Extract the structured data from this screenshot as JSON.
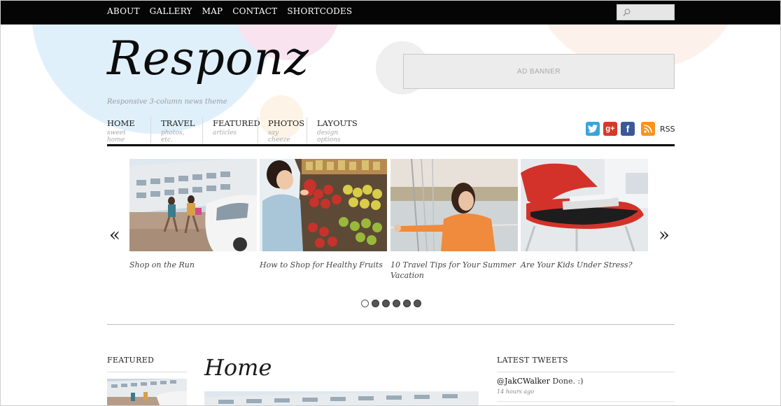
{
  "topnav": {
    "items": [
      {
        "label": "ABOUT"
      },
      {
        "label": "GALLERY"
      },
      {
        "label": "MAP"
      },
      {
        "label": "CONTACT"
      },
      {
        "label": "SHORTCODES"
      }
    ],
    "search": {
      "icon": "search-icon",
      "placeholder": ""
    }
  },
  "header": {
    "logo": "Responz",
    "tagline": "Responsive 3-column news theme",
    "ad_banner": "AD BANNER"
  },
  "mainnav": {
    "items": [
      {
        "label": "HOME",
        "sub": "sweet home"
      },
      {
        "label": "TRAVEL",
        "sub": "photos, etc."
      },
      {
        "label": "FEATURED",
        "sub": "articles"
      },
      {
        "label": "PHOTOS",
        "sub": "say cheeze"
      },
      {
        "label": "LAYOUTS",
        "sub": "design options"
      }
    ]
  },
  "social": {
    "icons": [
      "twitter-icon",
      "google-plus-icon",
      "facebook-icon",
      "rss-icon"
    ],
    "rss_label": "RSS",
    "colors": {
      "twitter": "#3aa3dc",
      "google_plus": "#d6392a",
      "facebook": "#3b5998",
      "rss": "#f7941d"
    }
  },
  "slider": {
    "prev": "«",
    "next": "»",
    "slides": [
      {
        "caption": "Shop on the Run"
      },
      {
        "caption": "How to Shop for Healthy Fruits"
      },
      {
        "caption": "10 Travel Tips for Your Summer Vacation"
      },
      {
        "caption": "Are Your Kids Under Stress?"
      }
    ],
    "dot_count": 6,
    "active_dot": 1
  },
  "featured": {
    "heading": "FEATURED"
  },
  "main": {
    "title": "Home"
  },
  "tweets": {
    "heading": "LATEST TWEETS",
    "items": [
      {
        "user": "@JakCWalker",
        "text": "Done. :)",
        "time": "14 hours ago"
      }
    ]
  }
}
